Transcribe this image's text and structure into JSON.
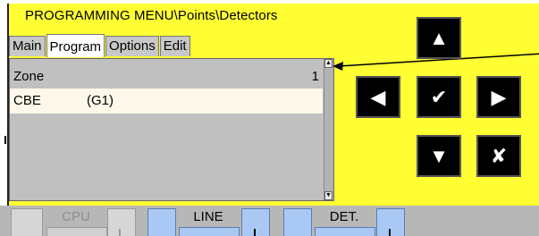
{
  "title": "PROGRAMMING MENU\\Points\\Detectors",
  "tabs": [
    "Main",
    "Program",
    "Options",
    "Edit"
  ],
  "list": {
    "header": {
      "label": "Zone",
      "value": "1"
    },
    "rows": [
      {
        "col1": "CBE",
        "col2": "(G1)"
      }
    ]
  },
  "nav_buttons": {
    "up": "▲",
    "left": "◀",
    "ok": "✔",
    "right": "▶",
    "down": "▼",
    "cancel": "✘"
  },
  "bottom": {
    "cpu": "CPU",
    "line": "LINE",
    "det": "DET."
  },
  "colors": {
    "panel": "#ffff33",
    "list_bg": "#c0c0c0",
    "selected_row": "#fdf8ea",
    "button": "#000000",
    "strip": "#b7b7b7",
    "slot": "#a9c8f3"
  }
}
